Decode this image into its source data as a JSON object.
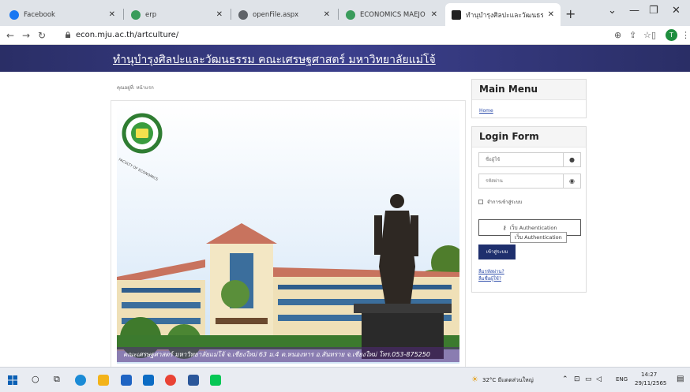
{
  "browser": {
    "tabs": [
      {
        "label": "Facebook",
        "color": "#1877f2"
      },
      {
        "label": "erp",
        "color": "#3a9c5c"
      },
      {
        "label": "openFile.aspx",
        "color": "#5f6368"
      },
      {
        "label": "ECONOMICS MAEJO",
        "color": "#3a9c5c"
      },
      {
        "label": "ทำนุบำรุงศิลปะและวัฒนธรรม",
        "color": "#222222"
      }
    ],
    "url": "econ.mju.ac.th/artculture/",
    "profile_initial": "T"
  },
  "site": {
    "banner_title": "ทำนุบำรุงศิลปะและวัฒนธรรม คณะเศรษฐศาสตร์ มหาวิทยาลัยแม่โจ้",
    "breadcrumb": "คุณอยู่ที่: หน้าแรก",
    "photo_caption": "คณะเศรษฐศาสตร์ มหาวิทยาลัยแม่โจ้ จ.เชียงใหม่ 63 ม.4 ต.หนองหาร อ.สันทราย จ.เชียงใหม่ โทร.053-875250",
    "logo_text_top": "มหาวิทยาลัยแม่โจ้",
    "logo_text_bottom": "MAEJO UNIVERSITY",
    "logo_faculty": "FACULTY OF ECONOMICS"
  },
  "main_menu": {
    "title": "Main Menu",
    "home_link": "Home"
  },
  "login": {
    "title": "Login Form",
    "username_placeholder": "ชื่อผู้ใช้",
    "password_placeholder": "รหัสผ่าน",
    "remember_label": "จำการเข้าสู่ระบบ",
    "auth_button": "เว็บ Authentication",
    "tooltip": "เว็บ Authentication",
    "login_button": "เข้าสู่ระบบ",
    "forgot_password": "ลืมรหัสผ่าน?",
    "forgot_username": "ลืมชื่อผู้ใช้?"
  },
  "taskbar": {
    "weather": "32°C มีแดดส่วนใหญ่",
    "lang": "ENG",
    "time": "14:27",
    "date": "29/11/2565"
  }
}
